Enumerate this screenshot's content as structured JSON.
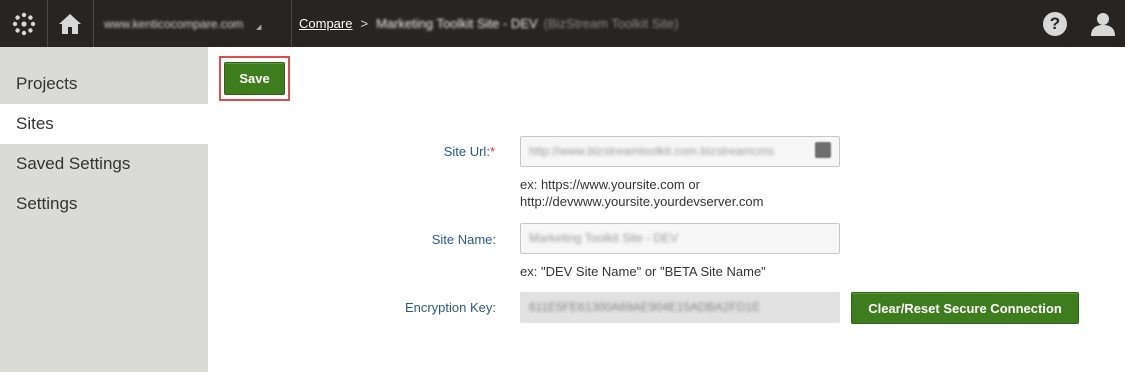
{
  "header": {
    "site_selector_value": "www.kenticocompare.com",
    "breadcrumb_link": "Compare",
    "breadcrumb_separator": ">",
    "breadcrumb_current": "Marketing Toolkit Site - DEV",
    "breadcrumb_sub": "(BizStream Toolkit Site)",
    "help_label": "?"
  },
  "sidebar": {
    "items": [
      {
        "label": "Projects",
        "active": false
      },
      {
        "label": "Sites",
        "active": true
      },
      {
        "label": "Saved Settings",
        "active": false
      },
      {
        "label": "Settings",
        "active": false
      }
    ]
  },
  "toolbar": {
    "save_label": "Save"
  },
  "form": {
    "site_url": {
      "label": "Site Url:",
      "required_mark": "*",
      "value": "http://www.bizstreamtoolkit.com.bizstreamcms",
      "hint_line1": "ex: https://www.yoursite.com or",
      "hint_line2": "http://devwww.yoursite.yourdevserver.com"
    },
    "site_name": {
      "label": "Site Name:",
      "value": "Marketing Toolkit Site - DEV",
      "hint": "ex: \"DEV Site Name\" or \"BETA Site Name\""
    },
    "encryption_key": {
      "label": "Encryption Key:",
      "value": "611E5FE61300A69AE904E15ADBA2FD1E",
      "reset_label": "Clear/Reset Secure Connection"
    }
  },
  "colors": {
    "topbar": "#262524",
    "sidebar": "#dadad8",
    "primary_button": "#3d7d1e",
    "label": "#2a5a8a",
    "highlight": "#e34b4b"
  }
}
